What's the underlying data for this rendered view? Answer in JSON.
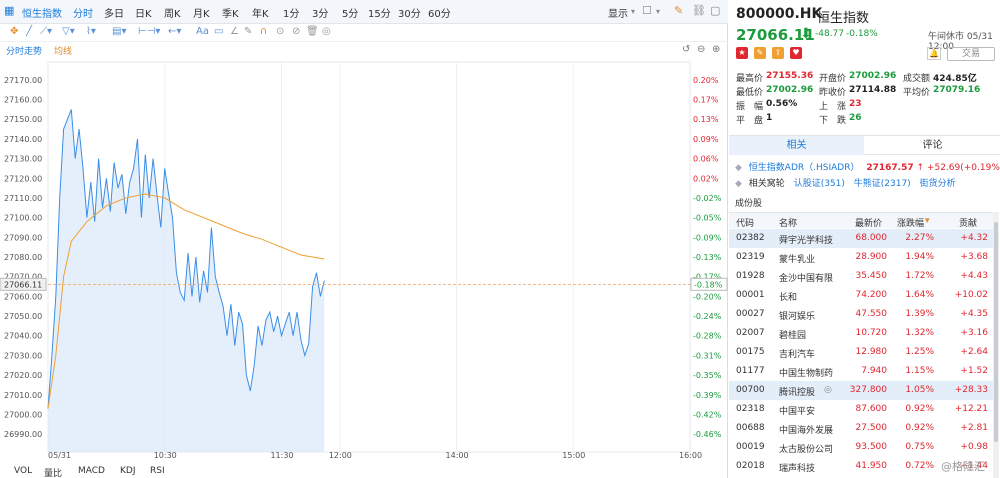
{
  "topbar": {
    "chart_name": "恒生指数",
    "periods": [
      "分时",
      "多日",
      "日K",
      "周K",
      "月K",
      "季K",
      "年K",
      "1分",
      "3分",
      "5分",
      "15分",
      "30分",
      "60分"
    ],
    "display_label": "显示"
  },
  "subtabs": {
    "intraday": "分时走势",
    "avg": "均线"
  },
  "bottom_tabs": [
    "VOL",
    "量比",
    "MACD",
    "KDJ",
    "RSI"
  ],
  "colors": {
    "up": "#e0262f",
    "down": "#1a9b3c",
    "accent": "#1e7bd9",
    "avg_line": "#f0a030",
    "price_line": "#3a8ee6"
  },
  "quote": {
    "code": "800000.HK",
    "name": "恒生指数",
    "price": "27066.11",
    "change": "-48.77",
    "change_pct": "-0.18%",
    "status": "午间休市 05/31 12:00",
    "trade_label": "交易",
    "fields": {
      "high_label": "最高价",
      "high": "27155.36",
      "open_label": "开盘价",
      "open": "27002.96",
      "turnover_label": "成交额",
      "turnover": "424.85亿",
      "low_label": "最低价",
      "low": "27002.96",
      "prev_label": "昨收价",
      "prev": "27114.88",
      "avg_label": "平均价",
      "avg": "27079.16",
      "amp_label": "振　幅",
      "amp": "0.56%",
      "rise_label": "上　涨",
      "rise": "23",
      "flat_label": "平　盘",
      "flat": "1",
      "fall_label": "下　跌",
      "fall": "26"
    }
  },
  "related": {
    "tab_related": "相关",
    "tab_comment": "评论",
    "adr_name": "恒生指数ADR（.HSIADR）",
    "adr_price": "27167.57",
    "adr_change": "+52.69(+0.19%)",
    "related_label": "相关窝轮",
    "warrants": "认股证(351)",
    "cbbc": "牛熊证(2317)",
    "analysis": "街货分析",
    "components_title": "成份股"
  },
  "table": {
    "headers": [
      "代码",
      "名称",
      "最新价",
      "涨跌幅",
      "贡献"
    ],
    "rows": [
      {
        "code": "02382",
        "name": "舜宇光学科技",
        "price": "68.000",
        "pct": "2.27%",
        "contrib": "+4.32"
      },
      {
        "code": "02319",
        "name": "蒙牛乳业",
        "price": "28.900",
        "pct": "1.94%",
        "contrib": "+3.68"
      },
      {
        "code": "01928",
        "name": "金沙中国有限",
        "price": "35.450",
        "pct": "1.72%",
        "contrib": "+4.43"
      },
      {
        "code": "00001",
        "name": "长和",
        "price": "74.200",
        "pct": "1.64%",
        "contrib": "+10.02"
      },
      {
        "code": "00027",
        "name": "银河娱乐",
        "price": "47.550",
        "pct": "1.39%",
        "contrib": "+4.35"
      },
      {
        "code": "02007",
        "name": "碧桂园",
        "price": "10.720",
        "pct": "1.32%",
        "contrib": "+3.16"
      },
      {
        "code": "00175",
        "name": "吉利汽车",
        "price": "12.980",
        "pct": "1.25%",
        "contrib": "+2.64"
      },
      {
        "code": "01177",
        "name": "中国生物制药",
        "price": "7.940",
        "pct": "1.15%",
        "contrib": "+1.52"
      },
      {
        "code": "00700",
        "name": "腾讯控股",
        "price": "327.800",
        "pct": "1.05%",
        "contrib": "+28.33"
      },
      {
        "code": "02318",
        "name": "中国平安",
        "price": "87.600",
        "pct": "0.92%",
        "contrib": "+12.21"
      },
      {
        "code": "00688",
        "name": "中国海外发展",
        "price": "27.500",
        "pct": "0.92%",
        "contrib": "+2.81"
      },
      {
        "code": "00019",
        "name": "太古股份公司",
        "price": "93.500",
        "pct": "0.75%",
        "contrib": "+0.98"
      },
      {
        "code": "02018",
        "name": "瑞声科技",
        "price": "41.950",
        "pct": "0.72%",
        "contrib": "+1.44"
      }
    ]
  },
  "watermark": "@格隆汇",
  "chart_data": {
    "type": "line",
    "ylim": [
      26985,
      27175
    ],
    "prev_close": 27114.88,
    "current_price_label": "27066.11",
    "current_pct_label": "-0.18%",
    "y_ticks": [
      {
        "v": 27170,
        "l": "27170.00",
        "p": "0.20%"
      },
      {
        "v": 27160,
        "l": "27160.00",
        "p": "0.17%"
      },
      {
        "v": 27150,
        "l": "27150.00",
        "p": "0.13%"
      },
      {
        "v": 27140,
        "l": "27140.00",
        "p": "0.09%"
      },
      {
        "v": 27130,
        "l": "27130.00",
        "p": "0.06%"
      },
      {
        "v": 27120,
        "l": "27120.00",
        "p": "0.02%"
      },
      {
        "v": 27110,
        "l": "27110.00",
        "p": "-0.02%"
      },
      {
        "v": 27100,
        "l": "27100.00",
        "p": "-0.05%"
      },
      {
        "v": 27090,
        "l": "27090.00",
        "p": "-0.09%"
      },
      {
        "v": 27080,
        "l": "27080.00",
        "p": "-0.13%"
      },
      {
        "v": 27070,
        "l": "27070.00",
        "p": "-0.17%"
      },
      {
        "v": 27060,
        "l": "27060.00",
        "p": "-0.20%"
      },
      {
        "v": 27050,
        "l": "27050.00",
        "p": "-0.24%"
      },
      {
        "v": 27040,
        "l": "27040.00",
        "p": "-0.28%"
      },
      {
        "v": 27030,
        "l": "27030.00",
        "p": "-0.31%"
      },
      {
        "v": 27020,
        "l": "27020.00",
        "p": "-0.35%"
      },
      {
        "v": 27010,
        "l": "27010.00",
        "p": "-0.39%"
      },
      {
        "v": 27000,
        "l": "27000.00",
        "p": "-0.42%"
      },
      {
        "v": 26990,
        "l": "26990.00",
        "p": "-0.46%"
      }
    ],
    "x_ticks": [
      {
        "t": 0,
        "l": "05/31"
      },
      {
        "t": 60,
        "l": "10:30"
      },
      {
        "t": 120,
        "l": "11:30"
      },
      {
        "t": 150,
        "l": "12:00"
      },
      {
        "t": 210,
        "l": "14:00"
      },
      {
        "t": 270,
        "l": "15:00"
      },
      {
        "t": 330,
        "l": "16:00"
      }
    ],
    "x_max": 330,
    "price": [
      [
        0,
        27003
      ],
      [
        2,
        27030
      ],
      [
        4,
        27060
      ],
      [
        6,
        27110
      ],
      [
        8,
        27145
      ],
      [
        10,
        27150
      ],
      [
        12,
        27155
      ],
      [
        14,
        27130
      ],
      [
        16,
        27145
      ],
      [
        18,
        27125
      ],
      [
        20,
        27100
      ],
      [
        22,
        27118
      ],
      [
        24,
        27098
      ],
      [
        26,
        27130
      ],
      [
        28,
        27105
      ],
      [
        30,
        27120
      ],
      [
        32,
        27103
      ],
      [
        34,
        27128
      ],
      [
        36,
        27115
      ],
      [
        38,
        27122
      ],
      [
        40,
        27102
      ],
      [
        42,
        27118
      ],
      [
        44,
        27125
      ],
      [
        46,
        27140
      ],
      [
        48,
        27100
      ],
      [
        50,
        27132
      ],
      [
        52,
        27110
      ],
      [
        54,
        27130
      ],
      [
        56,
        27112
      ],
      [
        58,
        27095
      ],
      [
        60,
        27125
      ],
      [
        62,
        27112
      ],
      [
        64,
        27100
      ],
      [
        66,
        27072
      ],
      [
        68,
        27062
      ],
      [
        70,
        27058
      ],
      [
        72,
        27082
      ],
      [
        74,
        27060
      ],
      [
        76,
        27080
      ],
      [
        78,
        27057
      ],
      [
        80,
        27073
      ],
      [
        82,
        27062
      ],
      [
        84,
        27095
      ],
      [
        86,
        27070
      ],
      [
        88,
        27062
      ],
      [
        90,
        27055
      ],
      [
        92,
        27040
      ],
      [
        94,
        27056
      ],
      [
        96,
        27035
      ],
      [
        98,
        27052
      ],
      [
        100,
        27046
      ],
      [
        102,
        27020
      ],
      [
        104,
        27012
      ],
      [
        106,
        27025
      ],
      [
        108,
        27045
      ],
      [
        110,
        27035
      ],
      [
        112,
        27048
      ],
      [
        114,
        27052
      ],
      [
        116,
        27042
      ],
      [
        118,
        27050
      ],
      [
        120,
        27040
      ],
      [
        122,
        27046
      ],
      [
        124,
        27052
      ],
      [
        126,
        27040
      ],
      [
        128,
        27052
      ],
      [
        130,
        27038
      ],
      [
        132,
        27030
      ],
      [
        134,
        27036
      ],
      [
        136,
        27065
      ],
      [
        138,
        27072
      ],
      [
        140,
        27060
      ],
      [
        142,
        27068
      ]
    ],
    "avg": [
      [
        0,
        27003
      ],
      [
        4,
        27030
      ],
      [
        8,
        27070
      ],
      [
        12,
        27088
      ],
      [
        20,
        27098
      ],
      [
        30,
        27106
      ],
      [
        40,
        27110
      ],
      [
        50,
        27112
      ],
      [
        60,
        27110
      ],
      [
        70,
        27104
      ],
      [
        80,
        27100
      ],
      [
        90,
        27096
      ],
      [
        100,
        27092
      ],
      [
        110,
        27089
      ],
      [
        120,
        27085
      ],
      [
        130,
        27081
      ],
      [
        142,
        27079
      ]
    ]
  }
}
